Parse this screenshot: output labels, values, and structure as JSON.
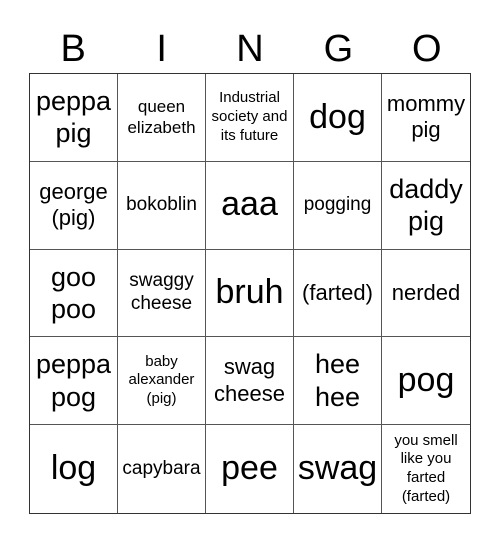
{
  "header": [
    "B",
    "I",
    "N",
    "G",
    "O"
  ],
  "cells": [
    "peppa pig",
    "queen elizabeth",
    "Industrial society and its future",
    "dog",
    "mommy pig",
    "george (pig)",
    "bokoblin",
    "aaa",
    "pogging",
    "daddy pig",
    "goo poo",
    "swaggy cheese",
    "bruh",
    "(farted)",
    "nerded",
    "peppa pog",
    "baby alexander (pig)",
    "swag cheese",
    "hee hee",
    "pog",
    "log",
    "capybara",
    "pee",
    "swag",
    "you smell like you farted (farted)"
  ]
}
